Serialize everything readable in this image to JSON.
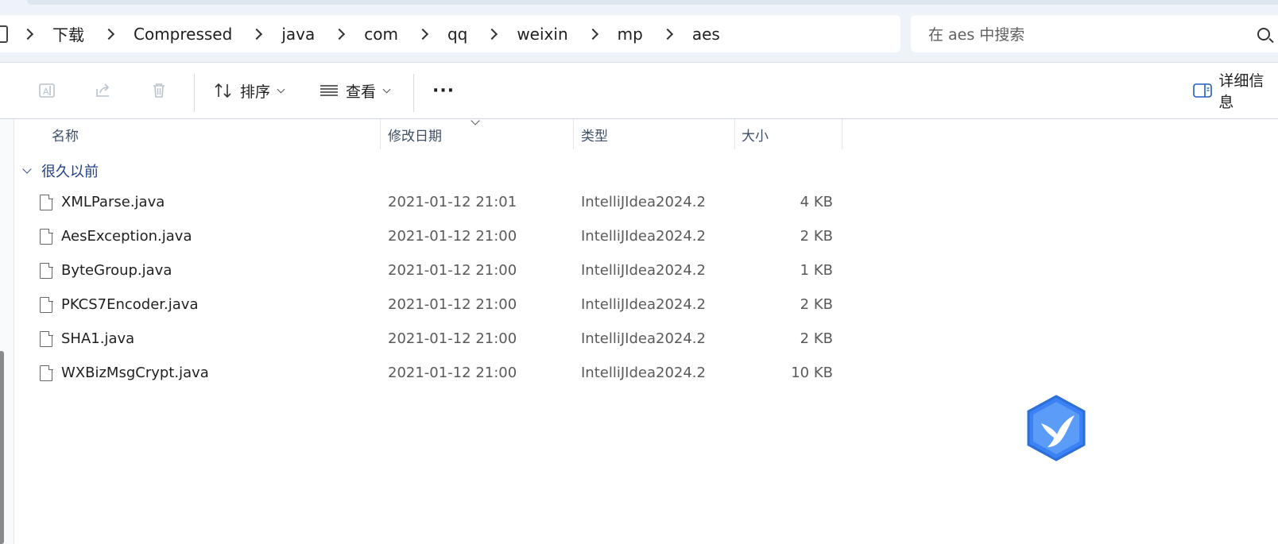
{
  "address_bar": {
    "breadcrumbs": [
      "下载",
      "Compressed",
      "java",
      "com",
      "qq",
      "weixin",
      "mp",
      "aes"
    ]
  },
  "search": {
    "placeholder": "在 aes 中搜索"
  },
  "toolbar": {
    "sort_label": "排序",
    "view_label": "查看",
    "more_label": "···",
    "details_label": "详细信息"
  },
  "columns": {
    "name": "名称",
    "modified": "修改日期",
    "type": "类型",
    "size": "大小"
  },
  "group": {
    "label": "很久以前"
  },
  "files": [
    {
      "name": "XMLParse.java",
      "modified": "2021-01-12 21:01",
      "type": "IntelliJIdea2024.2",
      "size": "4 KB"
    },
    {
      "name": "AesException.java",
      "modified": "2021-01-12 21:00",
      "type": "IntelliJIdea2024.2",
      "size": "2 KB"
    },
    {
      "name": "ByteGroup.java",
      "modified": "2021-01-12 21:00",
      "type": "IntelliJIdea2024.2",
      "size": "1 KB"
    },
    {
      "name": "PKCS7Encoder.java",
      "modified": "2021-01-12 21:00",
      "type": "IntelliJIdea2024.2",
      "size": "2 KB"
    },
    {
      "name": "SHA1.java",
      "modified": "2021-01-12 21:00",
      "type": "IntelliJIdea2024.2",
      "size": "2 KB"
    },
    {
      "name": "WXBizMsgCrypt.java",
      "modified": "2021-01-12 21:00",
      "type": "IntelliJIdea2024.2",
      "size": "10 KB"
    }
  ],
  "icons": {
    "rename": "rename-icon",
    "share": "share-icon",
    "delete": "trash-icon",
    "sort": "sort-arrows-icon",
    "view": "list-view-icon",
    "details": "details-pane-icon",
    "search": "search-icon",
    "file": "file-icon",
    "floating": "bird-logo-icon"
  },
  "colors": {
    "accent": "#1e3f8a",
    "logo_blue": "#3b82f6",
    "header_bg": "#eef3f9"
  }
}
